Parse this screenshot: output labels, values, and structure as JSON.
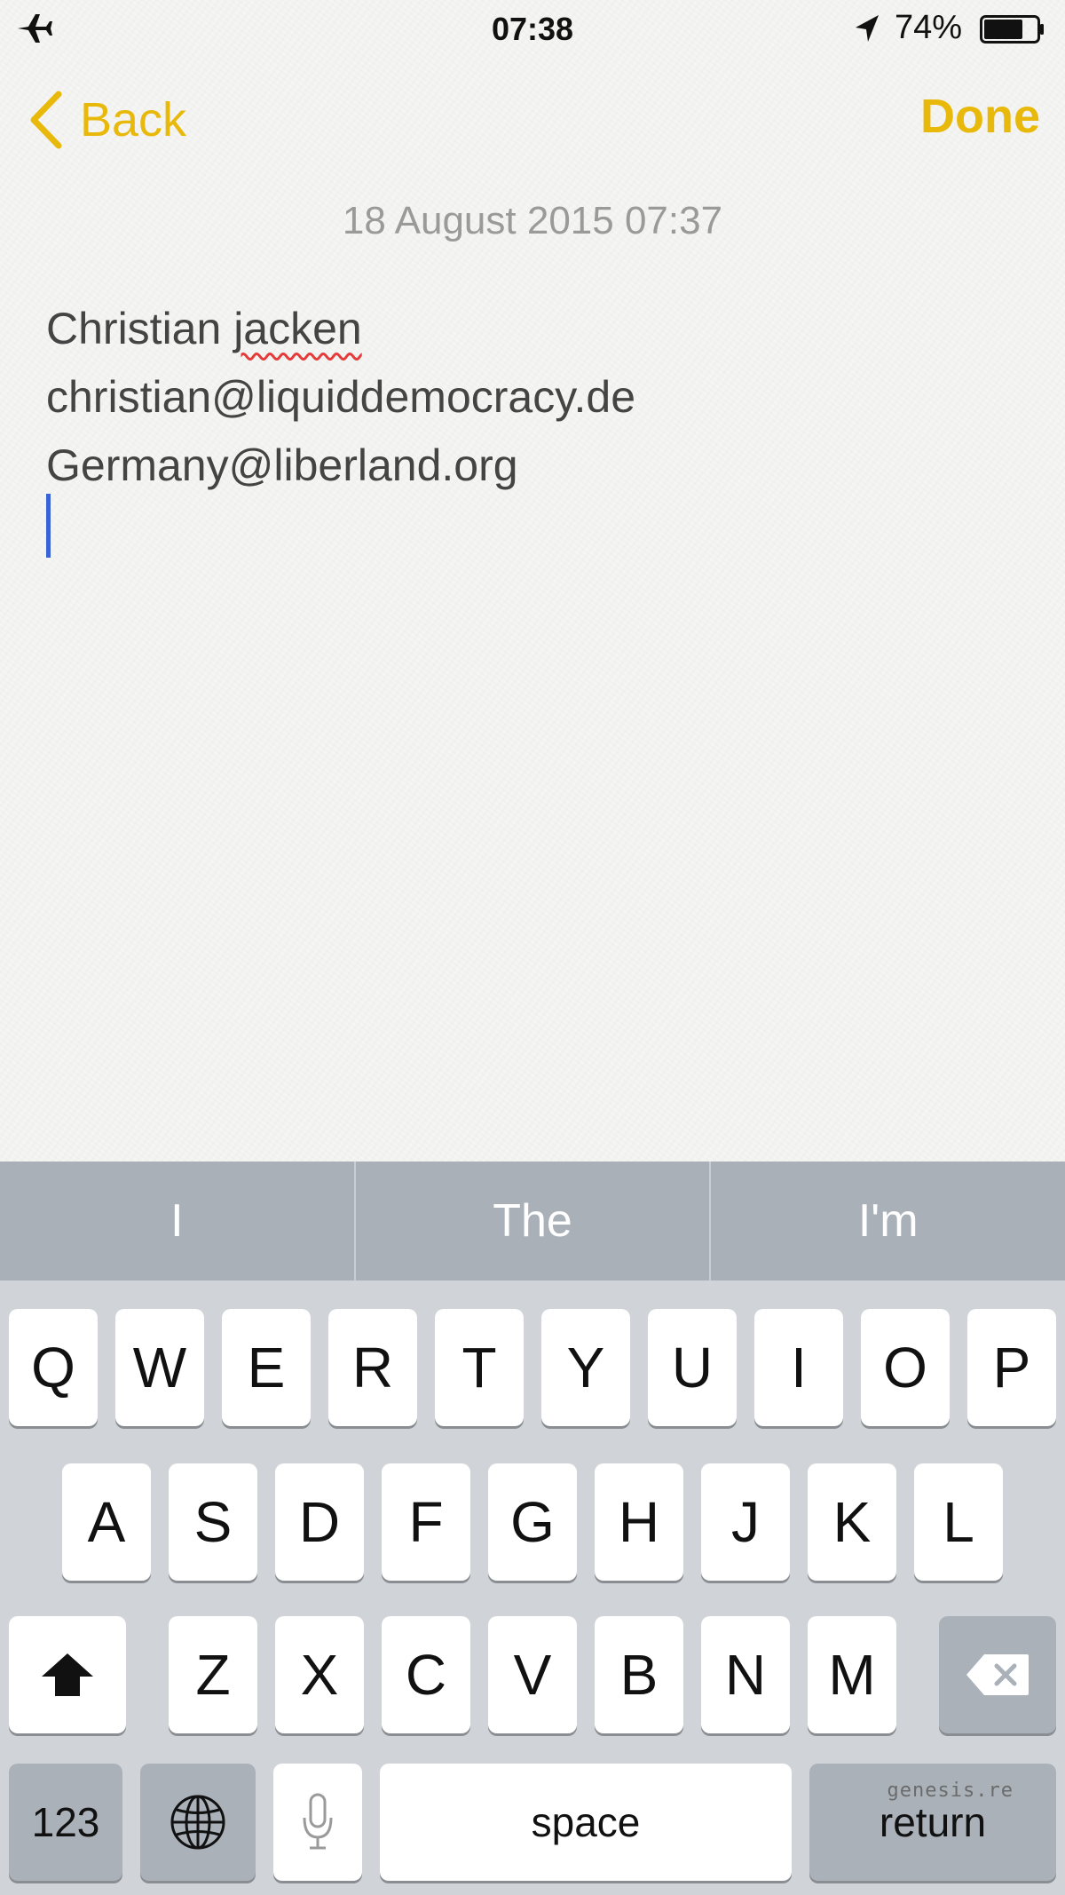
{
  "status_bar": {
    "time": "07:38",
    "battery_percent": "74%",
    "battery_level": 0.74,
    "airplane_icon": "airplane-icon",
    "location_icon": "location-arrow-icon",
    "battery_icon": "battery-icon"
  },
  "nav": {
    "back_label": "Back",
    "done_label": "Done",
    "accent_color": "#e8b90a"
  },
  "note": {
    "date": "18 August 2015 07:37",
    "lines": {
      "line1_word1": "Christian ",
      "line1_word2": "jacken",
      "line2": "christian@liquiddemocracy.de",
      "line3": "Germany@liberland.org"
    }
  },
  "predictions": [
    "I",
    "The",
    "I'm"
  ],
  "keyboard": {
    "row1": [
      "Q",
      "W",
      "E",
      "R",
      "T",
      "Y",
      "U",
      "I",
      "O",
      "P"
    ],
    "row2": [
      "A",
      "S",
      "D",
      "F",
      "G",
      "H",
      "J",
      "K",
      "L"
    ],
    "row3": [
      "Z",
      "X",
      "C",
      "V",
      "B",
      "N",
      "M"
    ],
    "numbers_label": "123",
    "space_label": "space",
    "return_label": "return"
  },
  "watermark": "genesis.re"
}
